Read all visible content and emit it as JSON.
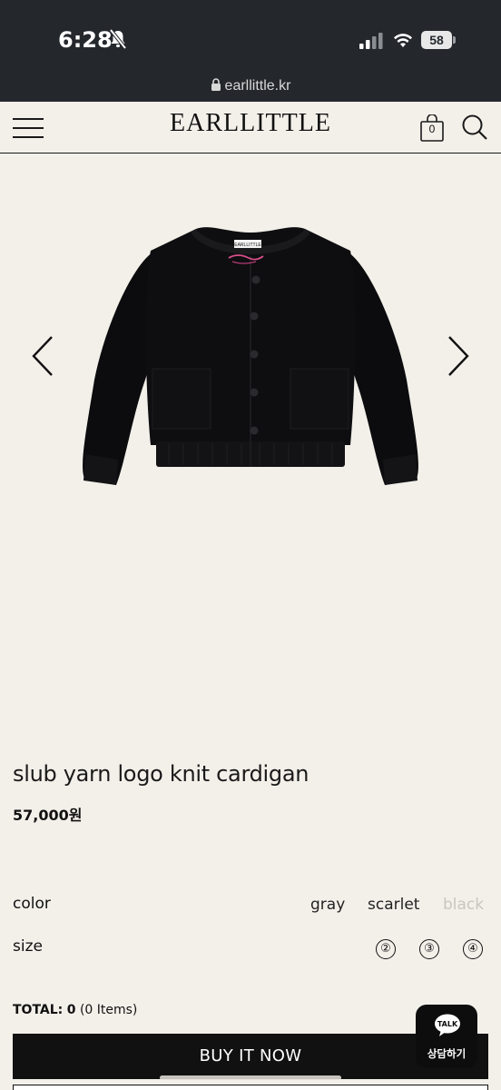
{
  "status_bar": {
    "time": "6:28",
    "battery": "58"
  },
  "browser": {
    "url": "earllittle.kr"
  },
  "header": {
    "logo": "EARLLITTLE",
    "cart_count": "0",
    "icons": [
      "menu-icon",
      "cart-icon",
      "search-icon"
    ]
  },
  "product": {
    "image_label": "EARLLITTLE",
    "name": "slub yarn logo knit cardigan",
    "price": "57,000원"
  },
  "options": {
    "color_label": "color",
    "colors": [
      {
        "name": "gray",
        "available": true
      },
      {
        "name": "scarlet",
        "available": true
      },
      {
        "name": "black",
        "available": false
      }
    ],
    "size_label": "size",
    "sizes": [
      "②",
      "③",
      "④"
    ]
  },
  "total": {
    "label": "TOTAL:",
    "amount": "0",
    "items": "(0 Items)"
  },
  "buy_button": "BUY IT NOW",
  "chat": {
    "bubble_text": "TALK",
    "label": "상담하기"
  },
  "colors": {
    "background": "#f3f0ea",
    "status_bar": "#24282d",
    "button": "#111111",
    "disabled_text": "#c9c6c0"
  }
}
